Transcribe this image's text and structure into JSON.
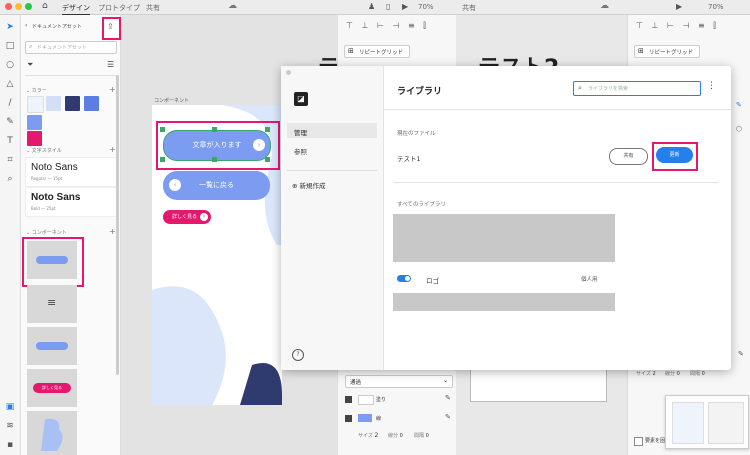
{
  "titlebar": {
    "tabs": [
      "デザイン",
      "プロトタイプ",
      "共有"
    ],
    "zoom_left": "70%",
    "zoom_right": "70%",
    "share_right": "共有"
  },
  "assets": {
    "back_label": "ドキュメントアセット",
    "search_placeholder": "ドキュメントアセット",
    "colors_header": "カラー",
    "char_styles_header": "文字スタイル",
    "components_header": "コンポーネント",
    "colors": [
      "#eef3fc",
      "#d3def8",
      "#2f3a6e",
      "#5a7de6",
      "#7b9cf0",
      "#e6186d"
    ],
    "text_styles": [
      {
        "name": "Noto Sans",
        "meta": "Regular — 15pt"
      },
      {
        "name": "Noto Sans",
        "meta": "Bold — 25pt"
      }
    ],
    "component_thumb_label": "詳しく見る"
  },
  "canvas": {
    "artboard_label": "コンポーネント",
    "button_main": "文章が入ります",
    "button_back": "一覧に戻る",
    "button_more": "詳しく見る",
    "title_fragment_left": "テ",
    "title_fragment_right": "テスト2"
  },
  "midpanel": {
    "repeat_grid": "リピートグリッド",
    "blend_mode": "通過",
    "fill_label": "塗り",
    "border_label": "線",
    "size_label": "サイズ",
    "size_value": "2",
    "dash_label": "線分",
    "dash_value": "0",
    "gap_label": "間隔",
    "gap_value": "0"
  },
  "rightpanel": {
    "repeat_grid": "リピートグリッド",
    "size_label": "サイズ",
    "size_value": "2",
    "dash_label": "線分",
    "dash_value": "0",
    "gap_label": "間隔",
    "gap_value": "0",
    "scroll_label": "要素を固定"
  },
  "modal": {
    "title": "ライブラリ",
    "search_placeholder": "ライブラリを検索",
    "nav": [
      {
        "label": "管理",
        "active": true
      },
      {
        "label": "参照",
        "active": false
      }
    ],
    "new_label": "新規作成",
    "current_file_header": "現在のファイル",
    "current_file_name": "テスト1",
    "share_button": "共有",
    "update_button": "更新",
    "all_libraries_header": "すべてのライブラリ",
    "library_item_name": "ロゴ",
    "library_item_owner": "個人用",
    "help": "?"
  }
}
